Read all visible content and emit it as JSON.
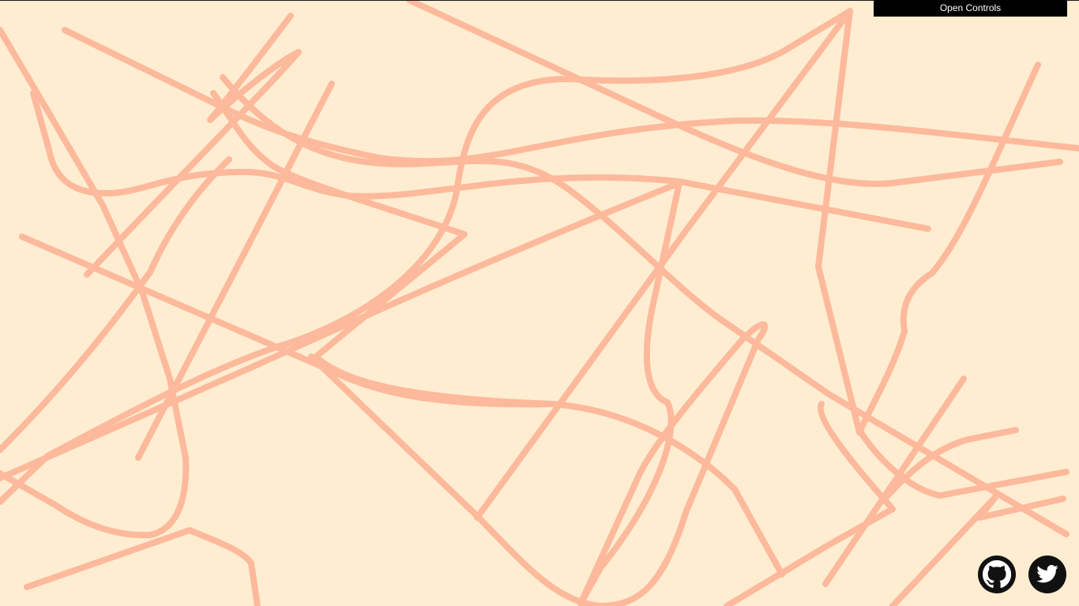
{
  "app": {
    "controls_button_label": "Open Controls"
  },
  "art": {
    "background_color": "#FFEDD2",
    "stroke_color": "#FDB99B",
    "stroke_width": 8
  },
  "social_links": [
    {
      "name": "github",
      "icon": "github-icon"
    },
    {
      "name": "twitter",
      "icon": "twitter-icon"
    }
  ],
  "colors": {
    "controls_bg": "#000000",
    "controls_text": "#ffffff",
    "icon_bg": "#111111",
    "icon_fg": "#ffffff"
  }
}
